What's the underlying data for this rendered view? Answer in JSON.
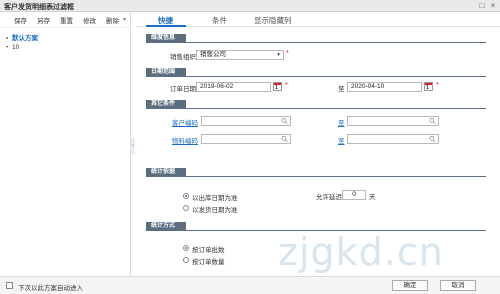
{
  "window": {
    "title": "客户发货明细表过滤框"
  },
  "sidebar": {
    "toolbar": {
      "save": "保存",
      "save_as": "另存",
      "reset": "重置",
      "edit": "修改",
      "delete": "删除"
    },
    "schemes": [
      {
        "label": "默认方案"
      },
      {
        "label": "10"
      }
    ]
  },
  "tabs": [
    {
      "label": "快捷"
    },
    {
      "label": "条件"
    },
    {
      "label": "显示隐藏列"
    }
  ],
  "sections": {
    "dimension": "维度信息",
    "date_range": "日期范围",
    "other": "其它条件",
    "stats_basis": "统计依据",
    "stats_method": "统计方式"
  },
  "fields": {
    "sales_org_label": "销售组织",
    "sales_org_value": "销售公司",
    "order_date_label": "订单日期",
    "order_date_from": "2019-06-02",
    "to_label": "至",
    "order_date_to": "2020-04-10",
    "customer_code_label": "客户编码",
    "material_code_label": "物料编码",
    "allow_delay_label": "允许延迟",
    "allow_delay_value": "0",
    "days_label": "天",
    "calendar_num": "1"
  },
  "radios": {
    "by_shipping_date": "以出库日期为准",
    "by_invoice_date": "以发货日期为准",
    "by_order_count": "按订单批数",
    "by_order_qty": "按订单数量"
  },
  "footer": {
    "auto_apply": "下次以此方案自动进入",
    "ok": "确定",
    "cancel": "取消"
  },
  "watermark": "zjgkd.cn"
}
